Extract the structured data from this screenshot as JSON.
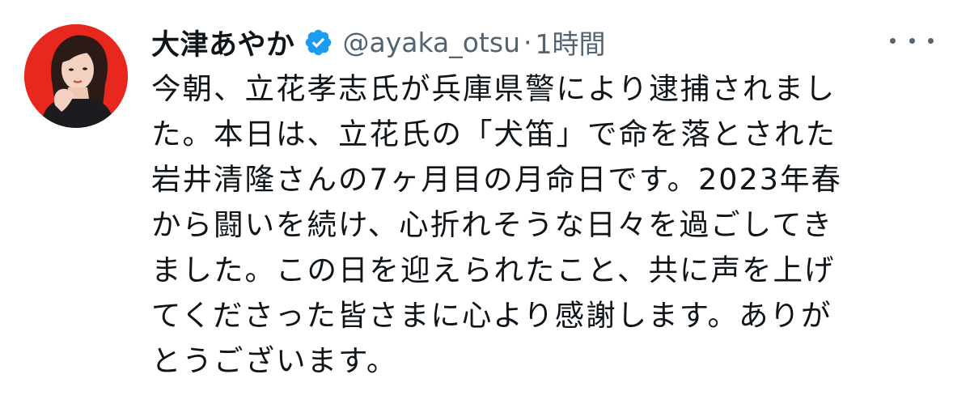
{
  "tweet": {
    "author_name": "大津あやか",
    "handle": "@ayaka_otsu",
    "separator": "·",
    "time": "1時間",
    "verified_icon": "verified-badge-icon",
    "more_icon": "more-options-icon",
    "lines": [
      "今朝、立花孝志氏が兵庫県警により逮捕されまし",
      "た。本日は、立花氏の「犬笛」で命を落とされた",
      "岩井清隆さんの7ヶ月目の月命日です。2023年春",
      "から闘いを続け、心折れそうな日々を過ごしてき",
      "ました。この日を迎えられたこと、共に声を上げ",
      "てくださった皆さまに心より感謝します。ありが",
      "とうございます。"
    ]
  },
  "colors": {
    "avatar_background": "#e8281e",
    "verified_blue": "#1d9bf0",
    "secondary_text": "#536471",
    "primary_text": "#0f1419"
  }
}
